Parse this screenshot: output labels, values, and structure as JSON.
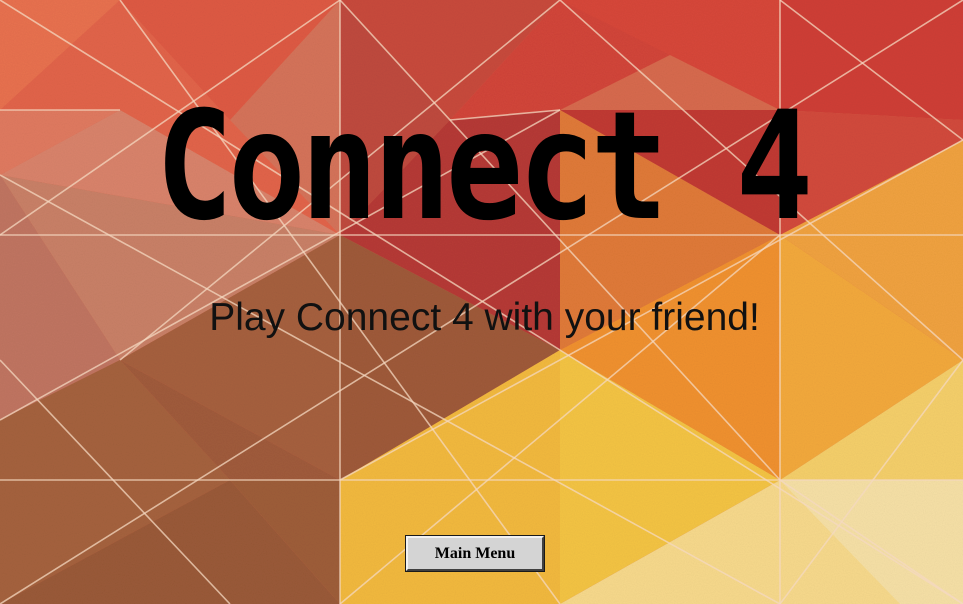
{
  "screen": {
    "title": "Connect 4",
    "subtitle": "Play Connect 4 with your friend!"
  },
  "buttons": {
    "main_menu_label": "Main Menu"
  },
  "background": {
    "style": "low-poly triangle pattern",
    "palette": [
      "#e4573c",
      "#c9413a",
      "#c88470",
      "#9e5a3a",
      "#f0922c",
      "#f5c340",
      "#f7d98c"
    ],
    "line_color": "#f6dcc4"
  }
}
